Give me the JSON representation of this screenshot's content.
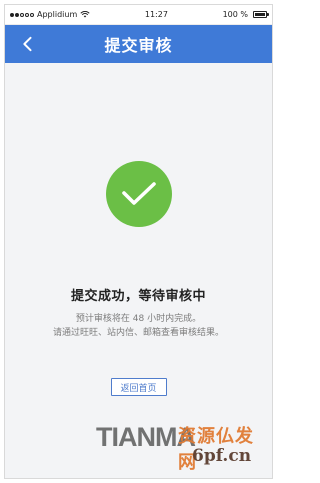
{
  "status_bar": {
    "carrier": "Applidium",
    "time": "11:27",
    "battery": "100 %"
  },
  "nav": {
    "title": "提交审核"
  },
  "success": {
    "title": "提交成功，等待审核中",
    "line1": "预计审核将在 48 小时内完成。",
    "line2": "请通过旺旺、站内信、邮箱查看审核结果。"
  },
  "actions": {
    "return_home": "返回首页"
  },
  "watermark": {
    "tian": "TIANMA",
    "cn": "资源仏发网",
    "domain": "6pf.cn"
  },
  "colors": {
    "nav_blue": "#3f7ad7",
    "success_green": "#6bbf46",
    "button_blue": "#4f7ccc",
    "background": "#f3f4f6"
  }
}
